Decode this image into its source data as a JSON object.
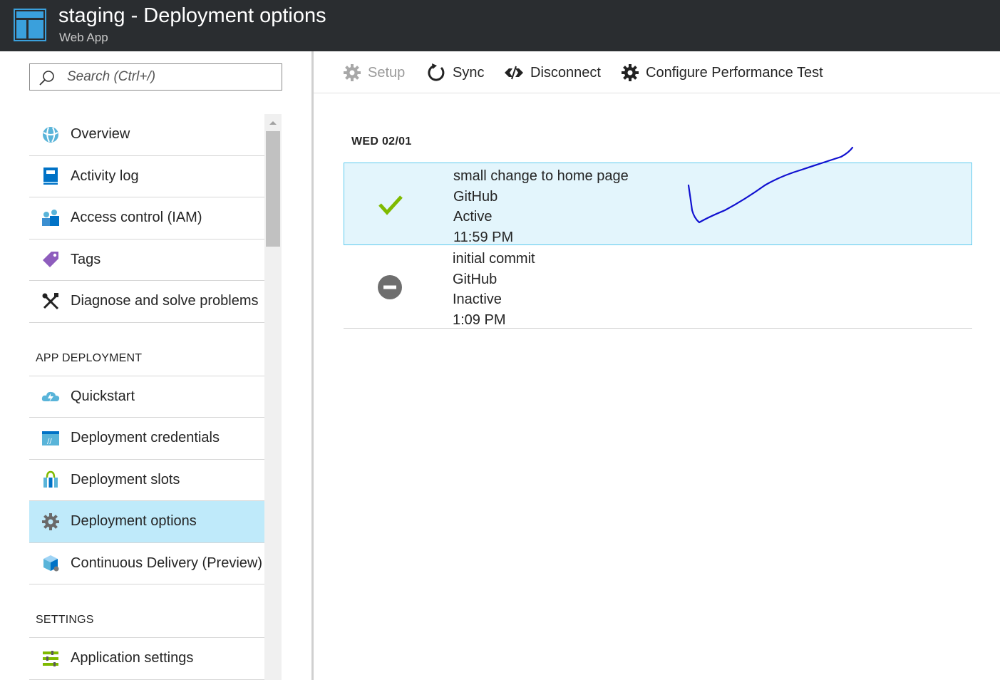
{
  "header": {
    "title": "staging - Deployment options",
    "subtitle": "Web App",
    "icon": "web-app-icon"
  },
  "search": {
    "placeholder": "Search (Ctrl+/)",
    "icon": "search-icon"
  },
  "sidebar": {
    "items": [
      {
        "label": "Overview",
        "icon": "globe-icon"
      },
      {
        "label": "Activity log",
        "icon": "book-icon"
      },
      {
        "label": "Access control (IAM)",
        "icon": "users-icon"
      },
      {
        "label": "Tags",
        "icon": "tag-icon"
      },
      {
        "label": "Diagnose and solve problems",
        "icon": "tools-icon"
      }
    ],
    "sections": [
      {
        "title": "APP DEPLOYMENT",
        "items": [
          {
            "label": "Quickstart",
            "icon": "cloud-bolt-icon"
          },
          {
            "label": "Deployment credentials",
            "icon": "credentials-icon"
          },
          {
            "label": "Deployment slots",
            "icon": "slots-icon"
          },
          {
            "label": "Deployment options",
            "icon": "gear-icon",
            "active": true
          },
          {
            "label": "Continuous Delivery (Preview)",
            "icon": "package-icon"
          }
        ]
      },
      {
        "title": "SETTINGS",
        "items": [
          {
            "label": "Application settings",
            "icon": "settings-list-icon"
          }
        ]
      }
    ]
  },
  "toolbar": {
    "setup_label": "Setup",
    "sync_label": "Sync",
    "disconnect_label": "Disconnect",
    "perf_label": "Configure Performance Test"
  },
  "deployments": {
    "date": "WED 02/01",
    "rows": [
      {
        "message": "small change to home page",
        "source": "GitHub",
        "status": "Active",
        "time": "11:59 PM",
        "status_icon": "checkmark-icon"
      },
      {
        "message": "initial commit",
        "source": "GitHub",
        "status": "Inactive",
        "time": "1:09 PM",
        "status_icon": "inactive-icon"
      }
    ]
  },
  "colors": {
    "header_bg": "#2a2d30",
    "active_item_bg": "#bfeafa",
    "selected_row_bg": "#e3f5fc",
    "selected_row_border": "#5ecbef",
    "check_green": "#7fba00",
    "annotation_blue": "#1010d0"
  }
}
